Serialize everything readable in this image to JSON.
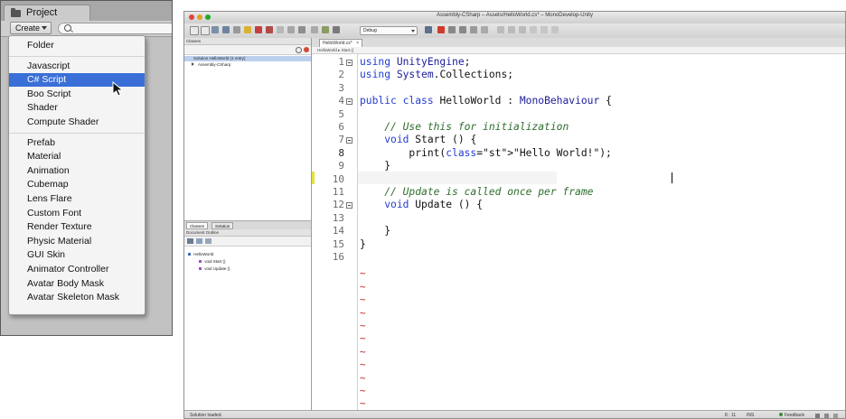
{
  "unity": {
    "tab_label": "Project",
    "create_label": "Create",
    "create_menu": {
      "groups": [
        [
          "Folder"
        ],
        [
          "Javascript",
          "C# Script",
          "Boo Script",
          "Shader",
          "Compute Shader"
        ],
        [
          "Prefab",
          "Material",
          "Animation",
          "Cubemap",
          "Lens Flare",
          "Custom Font",
          "Render Texture",
          "Physic Material",
          "GUI Skin",
          "Animator Controller",
          "Avatar Body Mask",
          "Avatar Skeleton Mask"
        ]
      ],
      "selected": "C# Script"
    }
  },
  "monodevelop": {
    "window_title": "Assembly-CSharp – Assets/HelloWorld.cs* – MonoDevelop-Unity",
    "config_select": "Debug",
    "classes_pad": {
      "header": "Classes",
      "tree": [
        {
          "label": "Solution HelloWorld (1 entry)",
          "selected": true
        },
        {
          "label": "Assembly-CSharp",
          "selected": false
        }
      ],
      "tabs": [
        "Classes",
        "Solution"
      ]
    },
    "outline_pad": {
      "header": "Document Outline",
      "tree": [
        "HelloWorld",
        "void Start ()",
        "void Update ()"
      ]
    },
    "editor": {
      "tab_label": "HelloWorld.cs*",
      "path_bar": "HelloWorld ▸ Start ()",
      "current_line": 8,
      "lines": [
        "using UnityEngine;",
        "using System.Collections;",
        "",
        "public class HelloWorld : MonoBehaviour {",
        "",
        "    // Use this for initialization",
        "    void Start () {",
        "        print(\"Hello World!\");",
        "    }",
        "",
        "    // Update is called once per frame",
        "    void Update () {",
        "",
        "    }",
        "}",
        ""
      ],
      "fold_lines": [
        1,
        4,
        7,
        12
      ],
      "empty_marker": "~",
      "empty_marker_rows": 11
    },
    "status": {
      "message": "Solution loaded.",
      "position": "8 : 11",
      "mode": "INS",
      "feedback": "Feedback"
    }
  },
  "colors": {
    "menu_selection": "#3a6fd8",
    "keyword": "#233cd1",
    "comment": "#2e6d2e",
    "string": "#c0159e",
    "tilde": "#c02020"
  }
}
